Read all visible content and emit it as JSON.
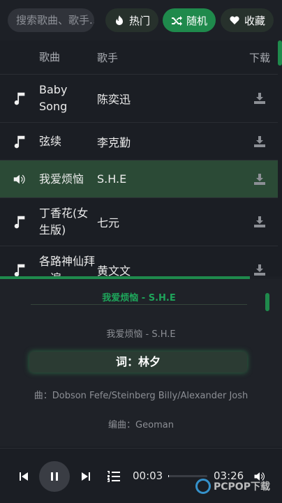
{
  "search": {
    "placeholder": "搜索歌曲、歌手..."
  },
  "tabs": [
    {
      "label": "热门",
      "icon": "flame-icon"
    },
    {
      "label": "随机",
      "icon": "shuffle-icon"
    },
    {
      "label": "收藏",
      "icon": "heart-icon"
    }
  ],
  "list": {
    "headers": {
      "title": "歌曲",
      "artist": "歌手",
      "download": "下载"
    },
    "songs": [
      {
        "title": "Baby Song",
        "artist": "陈奕迅",
        "playing": false
      },
      {
        "title": "弦续",
        "artist": "李克勤",
        "playing": false
      },
      {
        "title": "我爱烦恼",
        "artist": "S.H.E",
        "playing": true
      },
      {
        "title": "丁香花(女生版)",
        "artist": "七元",
        "playing": false
      },
      {
        "title": "各路神仙拜一遍",
        "artist": "黄文文",
        "playing": false
      }
    ]
  },
  "lyrics": {
    "header": "我爱烦恼 - S.H.E",
    "lines": [
      "我爱烦恼 - S.H.E",
      "词：林夕",
      "曲：Dobson Fefe/Steinberg Billy/Alexander Josh",
      "编曲：Geoman"
    ],
    "current_index": 1
  },
  "player": {
    "current_time": "00:03",
    "total_time": "03:26",
    "progress": 0.015
  },
  "colors": {
    "accent": "#1f8a4c",
    "playing_row": "#2b4a36",
    "background": "#1b1e24"
  },
  "watermark": {
    "text": "PCPOP下载"
  }
}
